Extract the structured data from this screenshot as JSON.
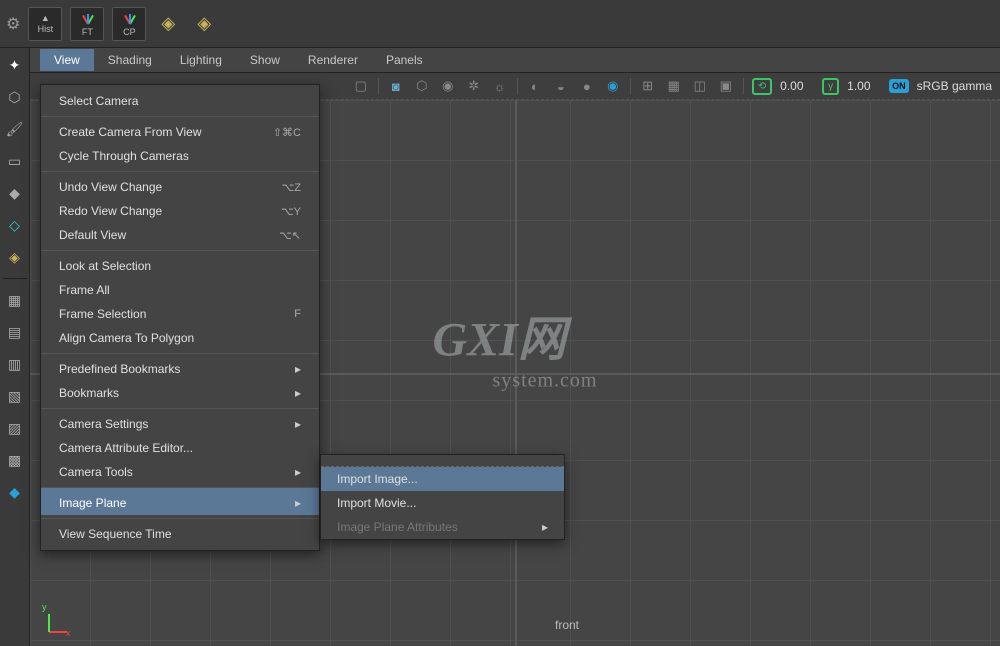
{
  "shelf": {
    "hist": "Hist",
    "ft": "FT",
    "cp": "CP"
  },
  "panelMenu": [
    "View",
    "Shading",
    "Lighting",
    "Show",
    "Renderer",
    "Panels"
  ],
  "iconbar": {
    "val1": "0.00",
    "val2": "1.00",
    "on": "ON",
    "gamma": "sRGB gamma"
  },
  "viewMenu": {
    "selectCamera": "Select Camera",
    "createCamera": "Create Camera From View",
    "createCameraSc": "⇧⌘C",
    "cycleCameras": "Cycle Through Cameras",
    "undoView": "Undo View Change",
    "undoSc": "⌥Z",
    "redoView": "Redo View Change",
    "redoSc": "⌥Y",
    "defaultView": "Default View",
    "defaultSc": "⌥↖",
    "lookAt": "Look at Selection",
    "frameAll": "Frame All",
    "frameSel": "Frame Selection",
    "frameSelSc": "F",
    "alignCam": "Align Camera To Polygon",
    "preBookmarks": "Predefined Bookmarks",
    "bookmarks": "Bookmarks",
    "camSettings": "Camera Settings",
    "camAttr": "Camera Attribute Editor...",
    "camTools": "Camera Tools",
    "imagePlane": "Image Plane",
    "viewSeq": "View Sequence Time"
  },
  "submenu": {
    "importImage": "Import Image...",
    "importMovie": "Import Movie...",
    "ipAttr": "Image Plane Attributes"
  },
  "watermark": {
    "big": "GXI",
    "net": "网",
    "small": "system.com"
  },
  "camLabel": "front"
}
